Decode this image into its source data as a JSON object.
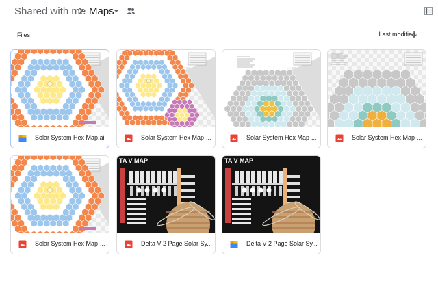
{
  "breadcrumb": {
    "root": "Shared with me",
    "current": "Maps"
  },
  "icons": {
    "separator": "chevron-right-icon",
    "caret": "caret-down-icon",
    "shared": "people-icon",
    "view": "list-view-icon",
    "sort": "arrow-down-icon"
  },
  "files_section": {
    "label": "Files",
    "sort_label": "Last modified"
  },
  "colors": {
    "accent": "#1a73e8",
    "pdf_red": "#ea4335",
    "ai_yellow": "#fbbc04",
    "ai_blue": "#4285f4",
    "hex_orange": "#f4874b",
    "hex_blue": "#9cc6ec",
    "hex_yellow": "#fde98a",
    "hex_purple": "#c47ab6",
    "hex_teal": "#8ec9c2"
  },
  "files": [
    {
      "name": "Solar System Hex Map.ai",
      "type": "illustrator",
      "type_icon": "illustrator-file-icon"
    },
    {
      "name": "Solar System Hex Map-...",
      "type": "pdf",
      "type_icon": "pdf-file-icon"
    },
    {
      "name": "Solar System Hex Map-...",
      "type": "pdf",
      "type_icon": "pdf-file-icon"
    },
    {
      "name": "Solar System Hex Map-...",
      "type": "pdf",
      "type_icon": "pdf-file-icon"
    },
    {
      "name": "Solar System Hex Map-...",
      "type": "pdf",
      "type_icon": "pdf-file-icon"
    },
    {
      "name": "Delta V 2 Page Solar Sy...",
      "type": "pdf",
      "type_icon": "pdf-file-icon"
    },
    {
      "name": "Delta V 2 Page Solar Sy...",
      "type": "illustrator",
      "type_icon": "illustrator-file-icon"
    }
  ],
  "thumb_labels": {
    "delta_v_title": "TA V MAP"
  }
}
